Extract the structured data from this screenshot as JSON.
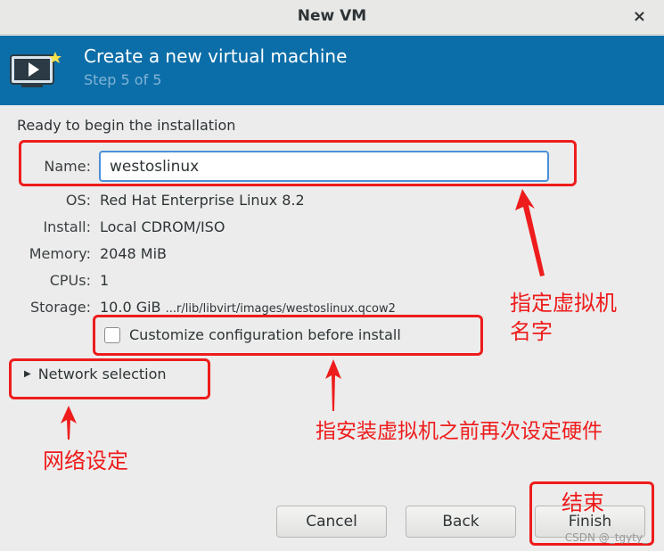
{
  "window": {
    "title": "New VM",
    "close_glyph": "×"
  },
  "banner": {
    "heading": "Create a new virtual machine",
    "step": "Step 5 of 5"
  },
  "content": {
    "ready_text": "Ready to begin the installation",
    "name_label": "Name:",
    "name_value": "westoslinux",
    "os_label": "OS:",
    "os_value": "Red Hat Enterprise Linux 8.2",
    "install_label": "Install:",
    "install_value": "Local CDROM/ISO",
    "memory_label": "Memory:",
    "memory_value": "2048 MiB",
    "cpus_label": "CPUs:",
    "cpus_value": "1",
    "storage_label": "Storage:",
    "storage_size": "10.0 GiB",
    "storage_path": "...r/lib/libvirt/images/westoslinux.qcow2",
    "customize_label": "Customize configuration before install",
    "customize_checked": false,
    "network_label": "Network selection"
  },
  "buttons": {
    "cancel": "Cancel",
    "back": "Back",
    "finish": "Finish"
  },
  "annotations": {
    "name_note_line1": "指定虚拟机",
    "name_note_line2": "名字",
    "customize_note": "指安装虚拟机之前再次设定硬件",
    "network_note": "网络设定",
    "finish_note": "结束",
    "color": "#ee1c1c"
  },
  "watermark": "CSDN @_tgyty_"
}
